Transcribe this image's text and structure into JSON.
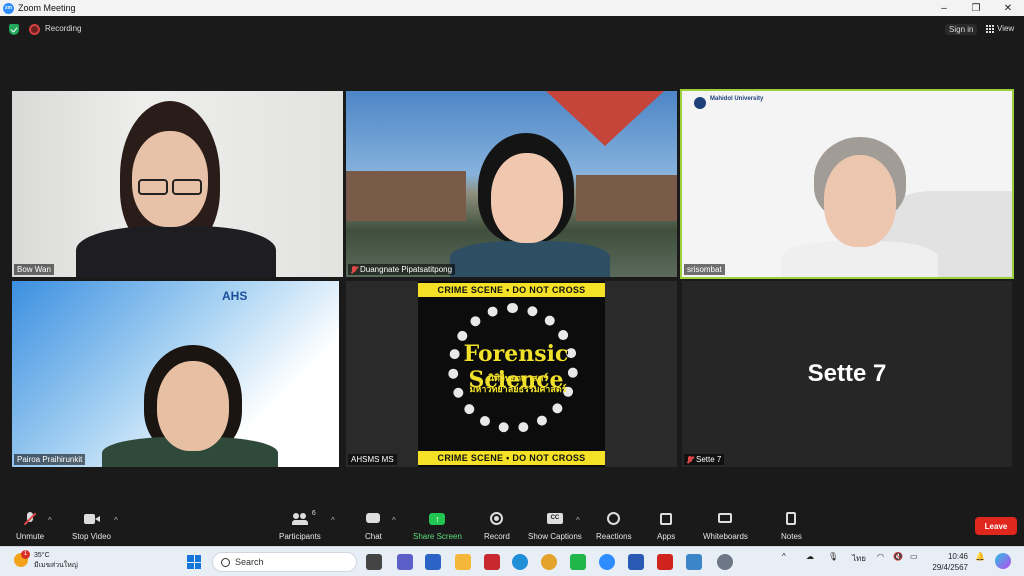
{
  "window": {
    "title": "Zoom Meeting",
    "controls": [
      "–",
      "❐",
      "✕"
    ]
  },
  "topbar": {
    "recording_label": "Recording",
    "signin_label": "Sign in",
    "view_label": "View"
  },
  "tiles": [
    {
      "name": "Bow Wan",
      "muted": false
    },
    {
      "name": "Duangnate Pipatsatitpong",
      "muted": true
    },
    {
      "name": "srisombat",
      "muted": false,
      "active_speaker": true,
      "slide_brand": "Mahidol University"
    },
    {
      "name": "Pairoa Praihirunkit",
      "muted": false,
      "slide_brand": "AHS"
    },
    {
      "name": "AHSMS MS",
      "muted": false
    },
    {
      "name": "Sette 7",
      "muted": true,
      "display_name": "Sette 7"
    }
  ],
  "poster": {
    "tape_text": "CRIME SCENE • DO NOT CROSS",
    "title": "Forensic Science",
    "subtitle_line1": "นิติวิทยาศาสตร์",
    "subtitle_line2": "มหาวิทยาลัยธรรมศาสตร์"
  },
  "toolbar": {
    "unmute": "Unmute",
    "stop_video": "Stop Video",
    "participants": "Participants",
    "participants_count": "6",
    "chat": "Chat",
    "share_screen": "Share Screen",
    "record": "Record",
    "show_captions": "Show Captions",
    "reactions": "Reactions",
    "apps": "Apps",
    "whiteboards": "Whiteboards",
    "notes": "Notes",
    "leave": "Leave"
  },
  "taskbar": {
    "weather_temp": "35°C",
    "weather_desc": "มีเมฆส่วนใหญ่",
    "weather_badge": "1",
    "search_placeholder": "Search",
    "lang": "ไทย",
    "time": "10:46",
    "date": "29/4/2567"
  },
  "colors": {
    "accent": "#2d8cff",
    "leave": "#e0271e",
    "share": "#23c552",
    "active_border": "#9ccf3a",
    "tape": "#f5e125"
  }
}
